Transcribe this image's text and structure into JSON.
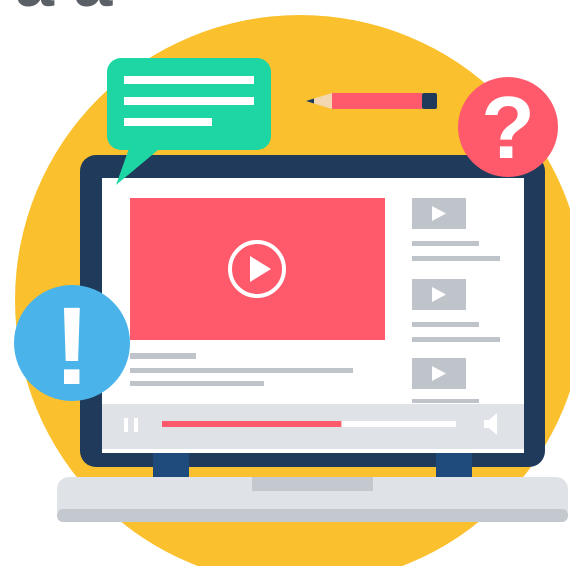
{
  "heading": {
    "text": "a a",
    "note": ""
  },
  "colors": {
    "background": "#ffffff",
    "sun": "#fbc02d",
    "laptop_frame": "#1f3a5a",
    "laptop_base": "#dfe3e8",
    "laptop_shadow": "#c4c8cf",
    "screen": "#ffffff",
    "video": "#ff5a6b",
    "thumb": "#bfc4cb",
    "line": "#bfc4cb",
    "chat": "#1ed6a4",
    "question": "#ff5a6b",
    "exclaim": "#4ab3ea",
    "pencil_body": "#ff5a6b",
    "pencil_cap": "#1f3a5a",
    "pencil_wood": "#f2d7b0",
    "progress_played": "#ff5a6b"
  },
  "player": {
    "progress": 0.61,
    "play_icon": "play-icon",
    "pause_icon": "pause-icon",
    "volume_icon": "volume-icon"
  },
  "badges": {
    "question_mark": "?",
    "exclamation_mark": "!"
  },
  "icons": {
    "chat": "chat-bubble-icon",
    "pencil": "pencil-icon",
    "thumbnail": "video-thumbnail-icon"
  }
}
